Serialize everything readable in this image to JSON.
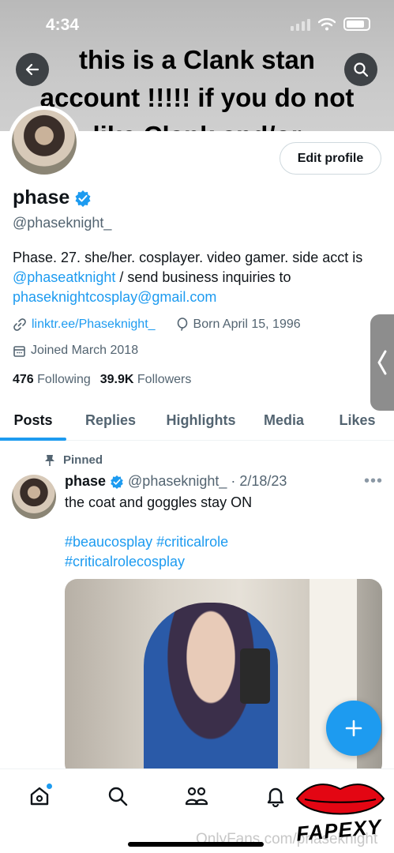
{
  "status_bar": {
    "time": "4:34"
  },
  "banner": {
    "text": "this is a Clank stan account !!!!! if you do not like Clank and/or"
  },
  "profile": {
    "edit_label": "Edit profile",
    "name": "phase",
    "handle": "@phaseknight_",
    "bio_part1": "Phase. 27. she/her. cosplayer. video gamer. side acct is ",
    "bio_link1": "@phaseatknight",
    "bio_part2": " / send business inquiries to ",
    "bio_email": "phaseknightcosplay@gmail.com",
    "website": "linktr.ee/Phaseknight_",
    "born": "Born April 15, 1996",
    "joined": "Joined March 2018",
    "following_count": "476",
    "following_label": "Following",
    "followers_count": "39.9K",
    "followers_label": "Followers"
  },
  "tabs": [
    {
      "label": "Posts"
    },
    {
      "label": "Replies"
    },
    {
      "label": "Highlights"
    },
    {
      "label": "Media"
    },
    {
      "label": "Likes"
    }
  ],
  "post": {
    "pinned_label": "Pinned",
    "name": "phase",
    "handle": "@phaseknight_",
    "date": "· 2/18/23",
    "text": "the coat and goggles stay ON",
    "hashtags_line1": "#beaucosplay #criticalrole",
    "hashtags_line2": "#criticalrolecosplay"
  },
  "watermark": {
    "text": "OnlyFans.com/phaseknight"
  },
  "logo": {
    "text": "FAPEXY"
  },
  "colors": {
    "accent": "#1d9bf0",
    "text": "#0f1419",
    "muted": "#536471"
  }
}
